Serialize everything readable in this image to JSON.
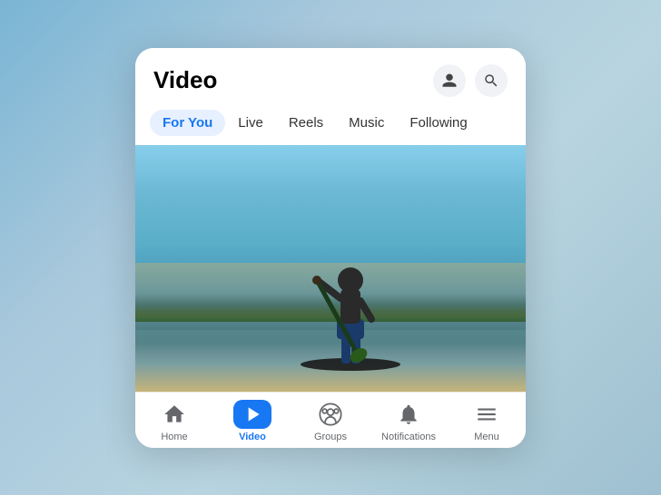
{
  "header": {
    "title": "Video",
    "profile_icon": "person-icon",
    "search_icon": "search-icon"
  },
  "tabs": [
    {
      "label": "For You",
      "active": true
    },
    {
      "label": "Live",
      "active": false
    },
    {
      "label": "Reels",
      "active": false
    },
    {
      "label": "Music",
      "active": false
    },
    {
      "label": "Following",
      "active": false
    }
  ],
  "nav": [
    {
      "label": "Home",
      "icon": "home-icon",
      "active": false
    },
    {
      "label": "Video",
      "icon": "video-nav-icon",
      "active": true
    },
    {
      "label": "Groups",
      "icon": "groups-icon",
      "active": false
    },
    {
      "label": "Notifications",
      "icon": "bell-icon",
      "active": false
    },
    {
      "label": "Menu",
      "icon": "menu-icon",
      "active": false
    }
  ],
  "colors": {
    "active_tab_bg": "#e7f0ff",
    "active_tab_text": "#1877f2",
    "active_nav_bg": "#1877f2"
  }
}
